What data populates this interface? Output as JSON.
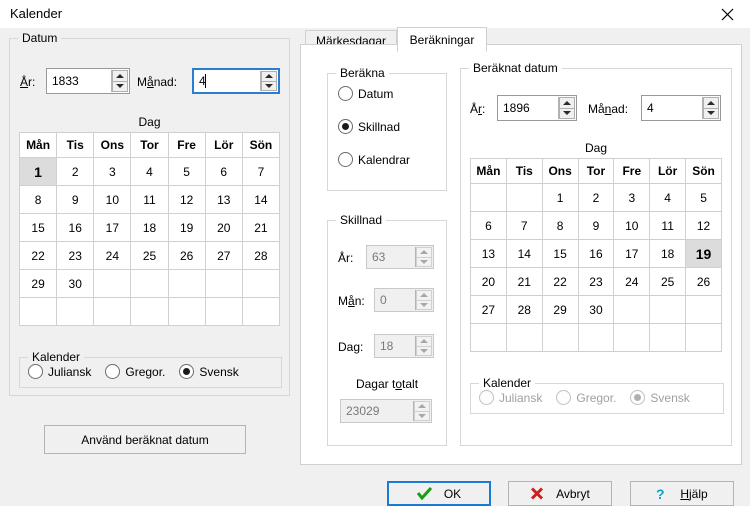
{
  "window": {
    "title": "Kalender",
    "close_icon": "close-icon"
  },
  "left_panel": {
    "group_title": "Datum",
    "year_label": "År:",
    "year_value": "1833",
    "month_label": "Månad:",
    "month_value": "4",
    "day_caption": "Dag",
    "weekdays": [
      "Mån",
      "Tis",
      "Ons",
      "Tor",
      "Fre",
      "Lör",
      "Sön"
    ],
    "weeks": [
      [
        "1",
        "2",
        "3",
        "4",
        "5",
        "6",
        "7"
      ],
      [
        "8",
        "9",
        "10",
        "11",
        "12",
        "13",
        "14"
      ],
      [
        "15",
        "16",
        "17",
        "18",
        "19",
        "20",
        "21"
      ],
      [
        "22",
        "23",
        "24",
        "25",
        "26",
        "27",
        "28"
      ],
      [
        "29",
        "30",
        "",
        "",
        "",
        "",
        ""
      ],
      [
        "",
        "",
        "",
        "",
        "",
        "",
        ""
      ]
    ],
    "selected_day": "1",
    "calendar_group_title": "Kalender",
    "calendar_options": [
      "Juliansk",
      "Gregor.",
      "Svensk"
    ],
    "calendar_selected": "Svensk",
    "use_button": "Använd beräknat datum"
  },
  "tabs": [
    {
      "label": "Märkesdagar",
      "active": false
    },
    {
      "label": "Beräkningar",
      "active": true
    }
  ],
  "berakna": {
    "group_title": "Beräkna",
    "options": [
      "Datum",
      "Skillnad",
      "Kalendrar"
    ],
    "selected": "Skillnad"
  },
  "skillnad": {
    "group_title": "Skillnad",
    "year_label": "År:",
    "year_value": "63",
    "month_label": "Mån:",
    "month_value": "0",
    "day_label": "Dag:",
    "day_value": "18",
    "total_label": "Dagar totalt",
    "total_value": "23029"
  },
  "berak_datum": {
    "group_title": "Beräknat datum",
    "year_label": "År:",
    "year_value": "1896",
    "month_label": "Månad:",
    "month_value": "4",
    "day_caption": "Dag",
    "weekdays": [
      "Mån",
      "Tis",
      "Ons",
      "Tor",
      "Fre",
      "Lör",
      "Sön"
    ],
    "weeks": [
      [
        "",
        "",
        "1",
        "2",
        "3",
        "4",
        "5"
      ],
      [
        "6",
        "7",
        "8",
        "9",
        "10",
        "11",
        "12"
      ],
      [
        "13",
        "14",
        "15",
        "16",
        "17",
        "18",
        "19"
      ],
      [
        "20",
        "21",
        "22",
        "23",
        "24",
        "25",
        "26"
      ],
      [
        "27",
        "28",
        "29",
        "30",
        "",
        "",
        ""
      ],
      [
        "",
        "",
        "",
        "",
        "",
        "",
        ""
      ]
    ],
    "selected_day": "19",
    "calendar_group_title": "Kalender",
    "calendar_options": [
      "Juliansk",
      "Gregor.",
      "Svensk"
    ],
    "calendar_selected": "Svensk"
  },
  "footer": {
    "ok_label": "OK",
    "ok_icon": "check-icon",
    "cancel_label": "Avbryt",
    "cancel_icon": "cross-icon",
    "help_label": "Hjälp",
    "help_icon": "question-icon"
  },
  "colors": {
    "accent": "#1a7ad4",
    "ok_check": "#12a012",
    "cancel_cross": "#cc2020",
    "help_question": "#0aa0c8",
    "selection_bg": "#dcdcdc",
    "window_bg": "#f0f0f0"
  }
}
